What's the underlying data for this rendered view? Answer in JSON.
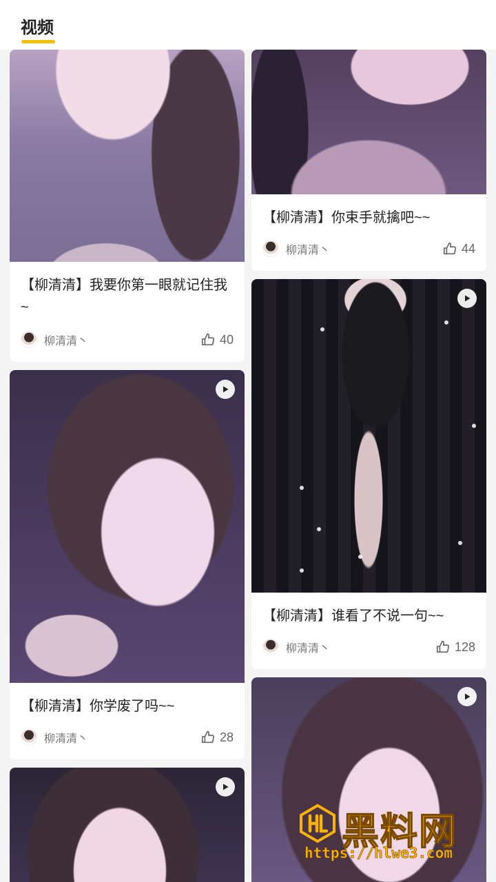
{
  "header": {
    "tab_label": "视频"
  },
  "cards": [
    {
      "title": "【柳清清】我要你第一眼就记住我~",
      "author": "柳清清丶",
      "likes": "40",
      "has_play": false
    },
    {
      "title": "【柳清清】你束手就擒吧~~",
      "author": "柳清清丶",
      "likes": "44",
      "has_play": false
    },
    {
      "title": "【柳清清】你学废了吗~~",
      "author": "柳清清丶",
      "likes": "28",
      "has_play": true
    },
    {
      "title": "【柳清清】谁看了不说一句~~",
      "author": "柳清清丶",
      "likes": "128",
      "has_play": true
    },
    {
      "title": "",
      "author": "",
      "likes": "",
      "has_play": true
    },
    {
      "title": "",
      "author": "",
      "likes": "",
      "has_play": true
    }
  ],
  "watermark": {
    "brand": "黑料网",
    "url": "https://hlwe3.com"
  },
  "icons": {
    "like": "thumbs-up-icon",
    "play": "play-icon",
    "avatar": "author-avatar"
  }
}
